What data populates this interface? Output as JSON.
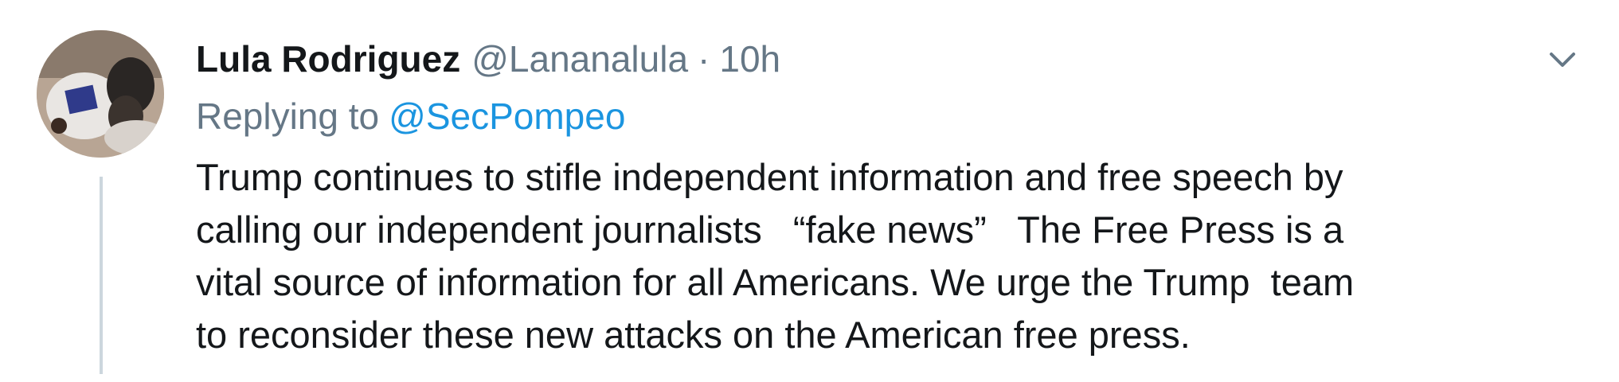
{
  "tweet": {
    "display_name": "Lula Rodriguez",
    "handle": "@Lananalula",
    "separator": "·",
    "time": "10h",
    "reply_label": "Replying to",
    "reply_handle": "@SecPompeo",
    "lines": [
      "Trump continues to stifle independent information and free speech by",
      "calling our independent journalists   “fake news”   The Free Press is a",
      "vital source of information for all Americans. We urge the Trump  team",
      "to reconsider these new attacks on the American free press."
    ],
    "icons": {
      "avatar": "avatar-photo",
      "more": "chevron-down-icon"
    },
    "colors": {
      "name": "#14171a",
      "secondary": "#657786",
      "link": "#1b95e0",
      "thread_line": "#ccd6dd"
    }
  }
}
